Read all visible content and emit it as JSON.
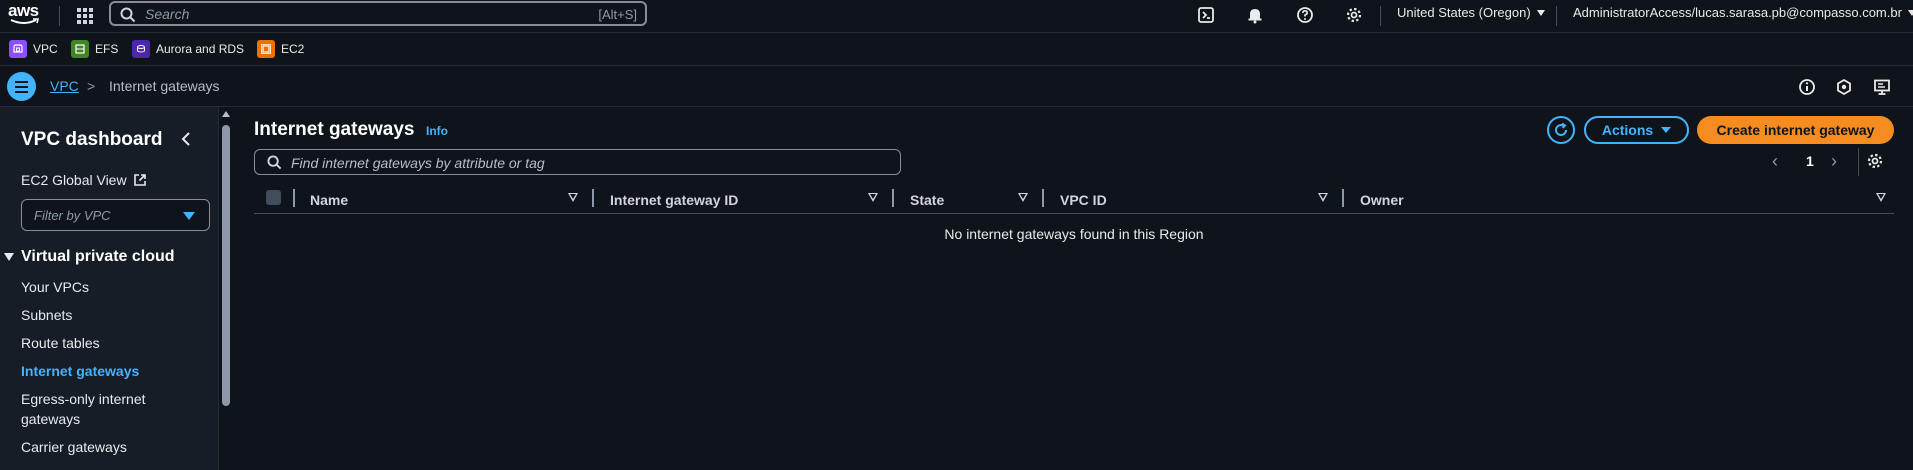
{
  "topnav": {
    "logo_text": "aws",
    "search_placeholder": "Search",
    "search_shortcut": "[Alt+S]",
    "region": "United States (Oregon)",
    "account": "AdministratorAccess/lucas.sarasa.pb@compasso.com.br"
  },
  "favorites": [
    {
      "label": "VPC",
      "color": "#8c4fff"
    },
    {
      "label": "EFS",
      "color": "#3f8624"
    },
    {
      "label": "Aurora and RDS",
      "color": "#4d27aa"
    },
    {
      "label": "EC2",
      "color": "#ed7100"
    }
  ],
  "breadcrumb": {
    "parent": "VPC",
    "separator": ">",
    "current": "Internet gateways"
  },
  "sidebar": {
    "title": "VPC dashboard",
    "ec2_global_view": "EC2 Global View",
    "filter_placeholder": "Filter by VPC",
    "section_title": "Virtual private cloud",
    "items": [
      {
        "label": "Your VPCs"
      },
      {
        "label": "Subnets"
      },
      {
        "label": "Route tables"
      },
      {
        "label": "Internet gateways",
        "active": true
      },
      {
        "label": "Egress-only internet gateways"
      },
      {
        "label": "Carrier gateways"
      }
    ]
  },
  "main": {
    "title": "Internet gateways",
    "info_link": "Info",
    "actions_label": "Actions",
    "create_label": "Create internet gateway",
    "search_placeholder": "Find internet gateways by attribute or tag",
    "page_number": "1",
    "columns": [
      "Name",
      "Internet gateway ID",
      "State",
      "VPC ID",
      "Owner"
    ],
    "empty_message": "No internet gateways found in this Region"
  },
  "colors": {
    "accent": "#42b4ff",
    "primary_button": "#f68c1f",
    "background": "#0f141a",
    "sidebar_bg": "#161d26"
  }
}
